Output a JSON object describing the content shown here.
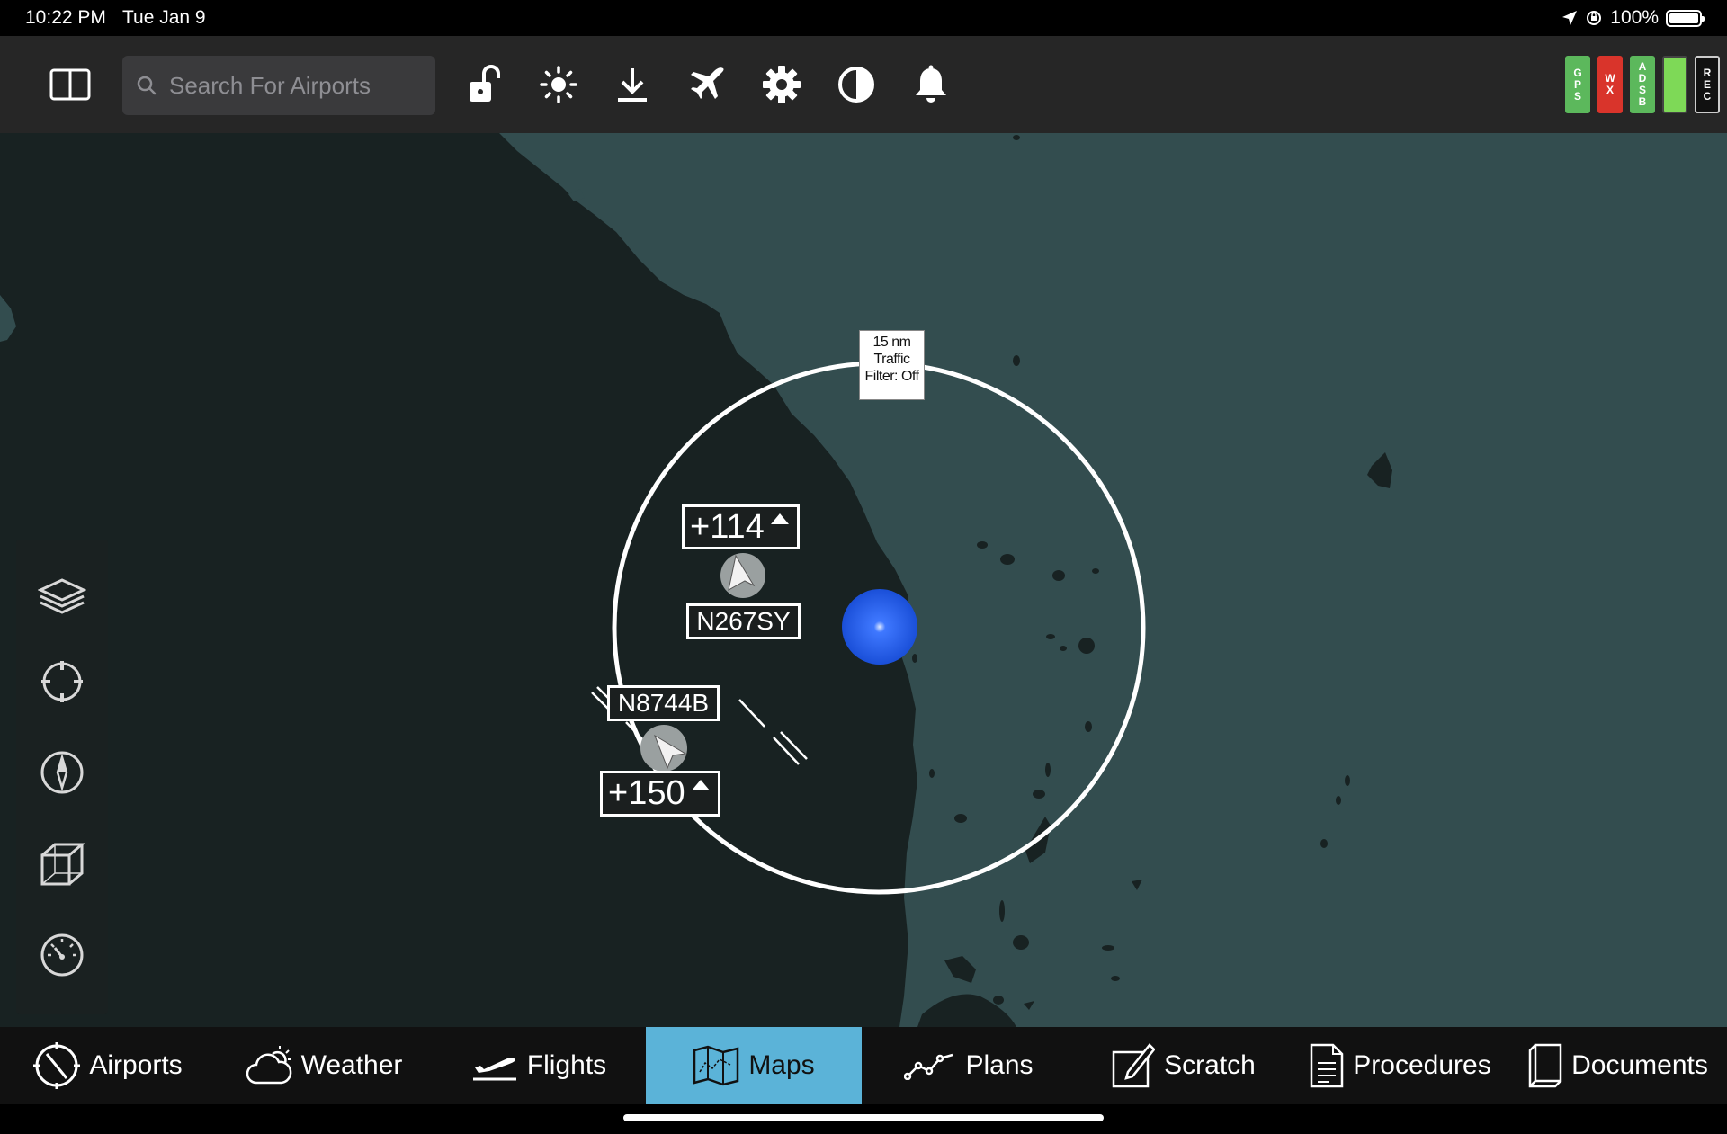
{
  "status_bar": {
    "time": "10:22 PM",
    "date": "Tue Jan 9",
    "battery": "100%"
  },
  "toolbar": {
    "search_placeholder": "Search For Airports",
    "icons": [
      "sidebar-toggle-icon",
      "unlock-icon",
      "brightness-icon",
      "download-icon",
      "airplane-icon",
      "gear-icon",
      "contrast-icon",
      "bell-icon"
    ],
    "status_pills": [
      {
        "label": "GPS",
        "color": "#5cb85c"
      },
      {
        "label": "WX",
        "color": "#d9342b"
      },
      {
        "label": "ADSB",
        "color": "#5cb85c"
      },
      {
        "label": "",
        "color": "#7ed957"
      },
      {
        "label": "REC",
        "color": "#111111"
      }
    ]
  },
  "map": {
    "water_color": "#334d4f",
    "land_color": "#182222",
    "traffic_ring": {
      "line1": "15 nm",
      "line2": "Traffic",
      "line3": "Filter: Off"
    },
    "traffic": [
      {
        "tail": "N267SY",
        "altitude": "+114",
        "trend": "climbing"
      },
      {
        "tail": "N8744B",
        "altitude": "+150",
        "trend": "climbing"
      }
    ],
    "ownship_color": "#2a62f0"
  },
  "rail": {
    "buttons": [
      "layers-icon",
      "crosshair-icon",
      "compass-icon",
      "cube-3d-icon",
      "gauge-icon"
    ]
  },
  "tabs": [
    {
      "label": "Airports",
      "icon": "airport-icon",
      "active": false
    },
    {
      "label": "Weather",
      "icon": "cloud-sun-icon",
      "active": false
    },
    {
      "label": "Flights",
      "icon": "departing-plane-icon",
      "active": false
    },
    {
      "label": "Maps",
      "icon": "map-icon",
      "active": true
    },
    {
      "label": "Plans",
      "icon": "route-icon",
      "active": false
    },
    {
      "label": "Scratch",
      "icon": "pencil-square-icon",
      "active": false
    },
    {
      "label": "Procedures",
      "icon": "document-lines-icon",
      "active": false
    },
    {
      "label": "Documents",
      "icon": "book-icon",
      "active": false
    }
  ]
}
